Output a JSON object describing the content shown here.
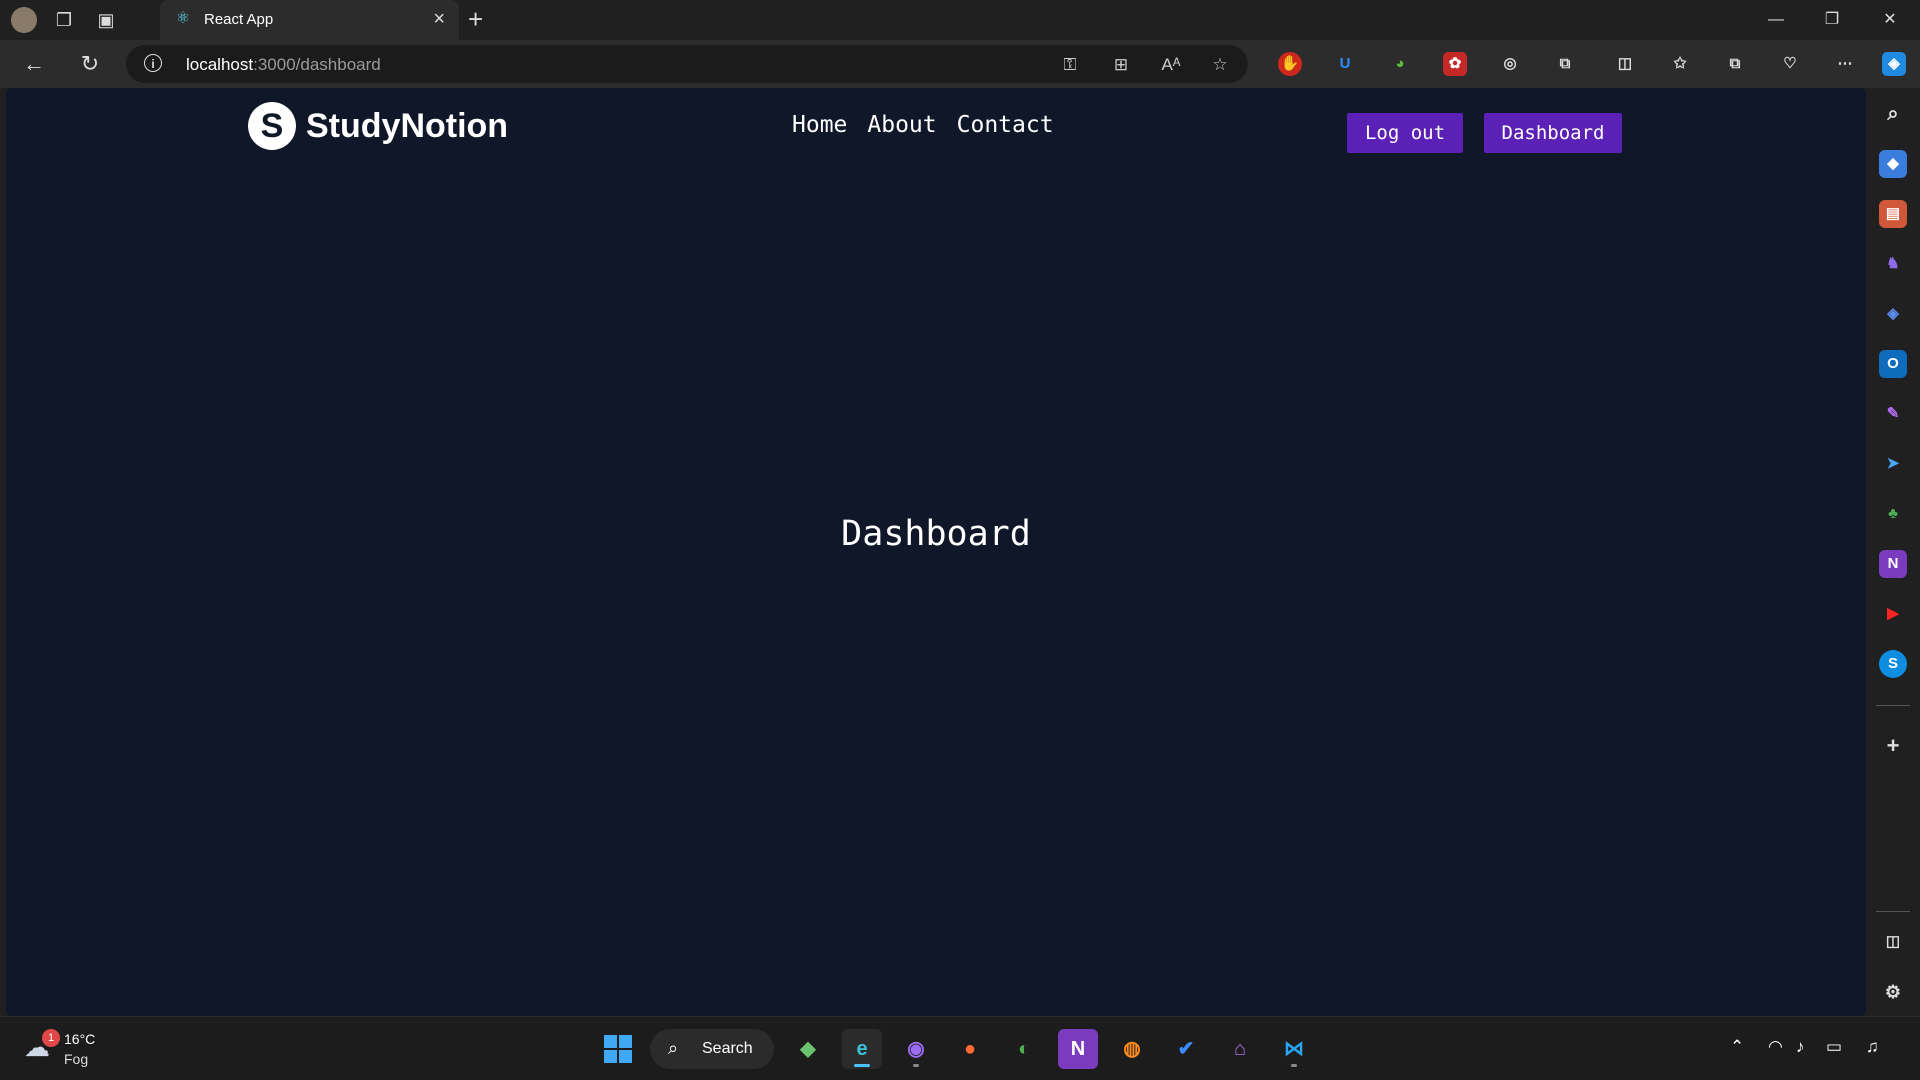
{
  "browser": {
    "tab_title": "React App",
    "url_host": "localhost",
    "url_path": ":3000/dashboard",
    "new_tab_symbol": "+",
    "icons": {
      "profile": "profile-avatar-icon",
      "workspaces": "workspaces-icon",
      "tab_actions": "tab-actions-icon",
      "back": "back-arrow-icon",
      "refresh": "refresh-icon",
      "info": "site-info-icon",
      "password": "key-icon",
      "apps": "apps-install-icon",
      "read_aloud": "read-aloud-icon",
      "favorite": "star-icon",
      "split": "split-screen-icon",
      "favorites_list": "favorites-icon",
      "collections": "collections-icon",
      "health": "browser-essentials-icon",
      "more": "more-icon",
      "copilot": "copilot-icon"
    }
  },
  "page": {
    "logo_letter": "S",
    "brand": "StudyNotion",
    "nav": [
      "Home",
      "About",
      "Contact"
    ],
    "buttons": {
      "logout": "Log out",
      "dashboard": "Dashboard"
    },
    "heading": "Dashboard",
    "colors": {
      "background": "#0f1729",
      "button": "#5b21b6"
    }
  },
  "taskbar": {
    "weather": {
      "temperature": "16°C",
      "condition": "Fog",
      "badge": "1"
    },
    "search_label": "Search"
  }
}
